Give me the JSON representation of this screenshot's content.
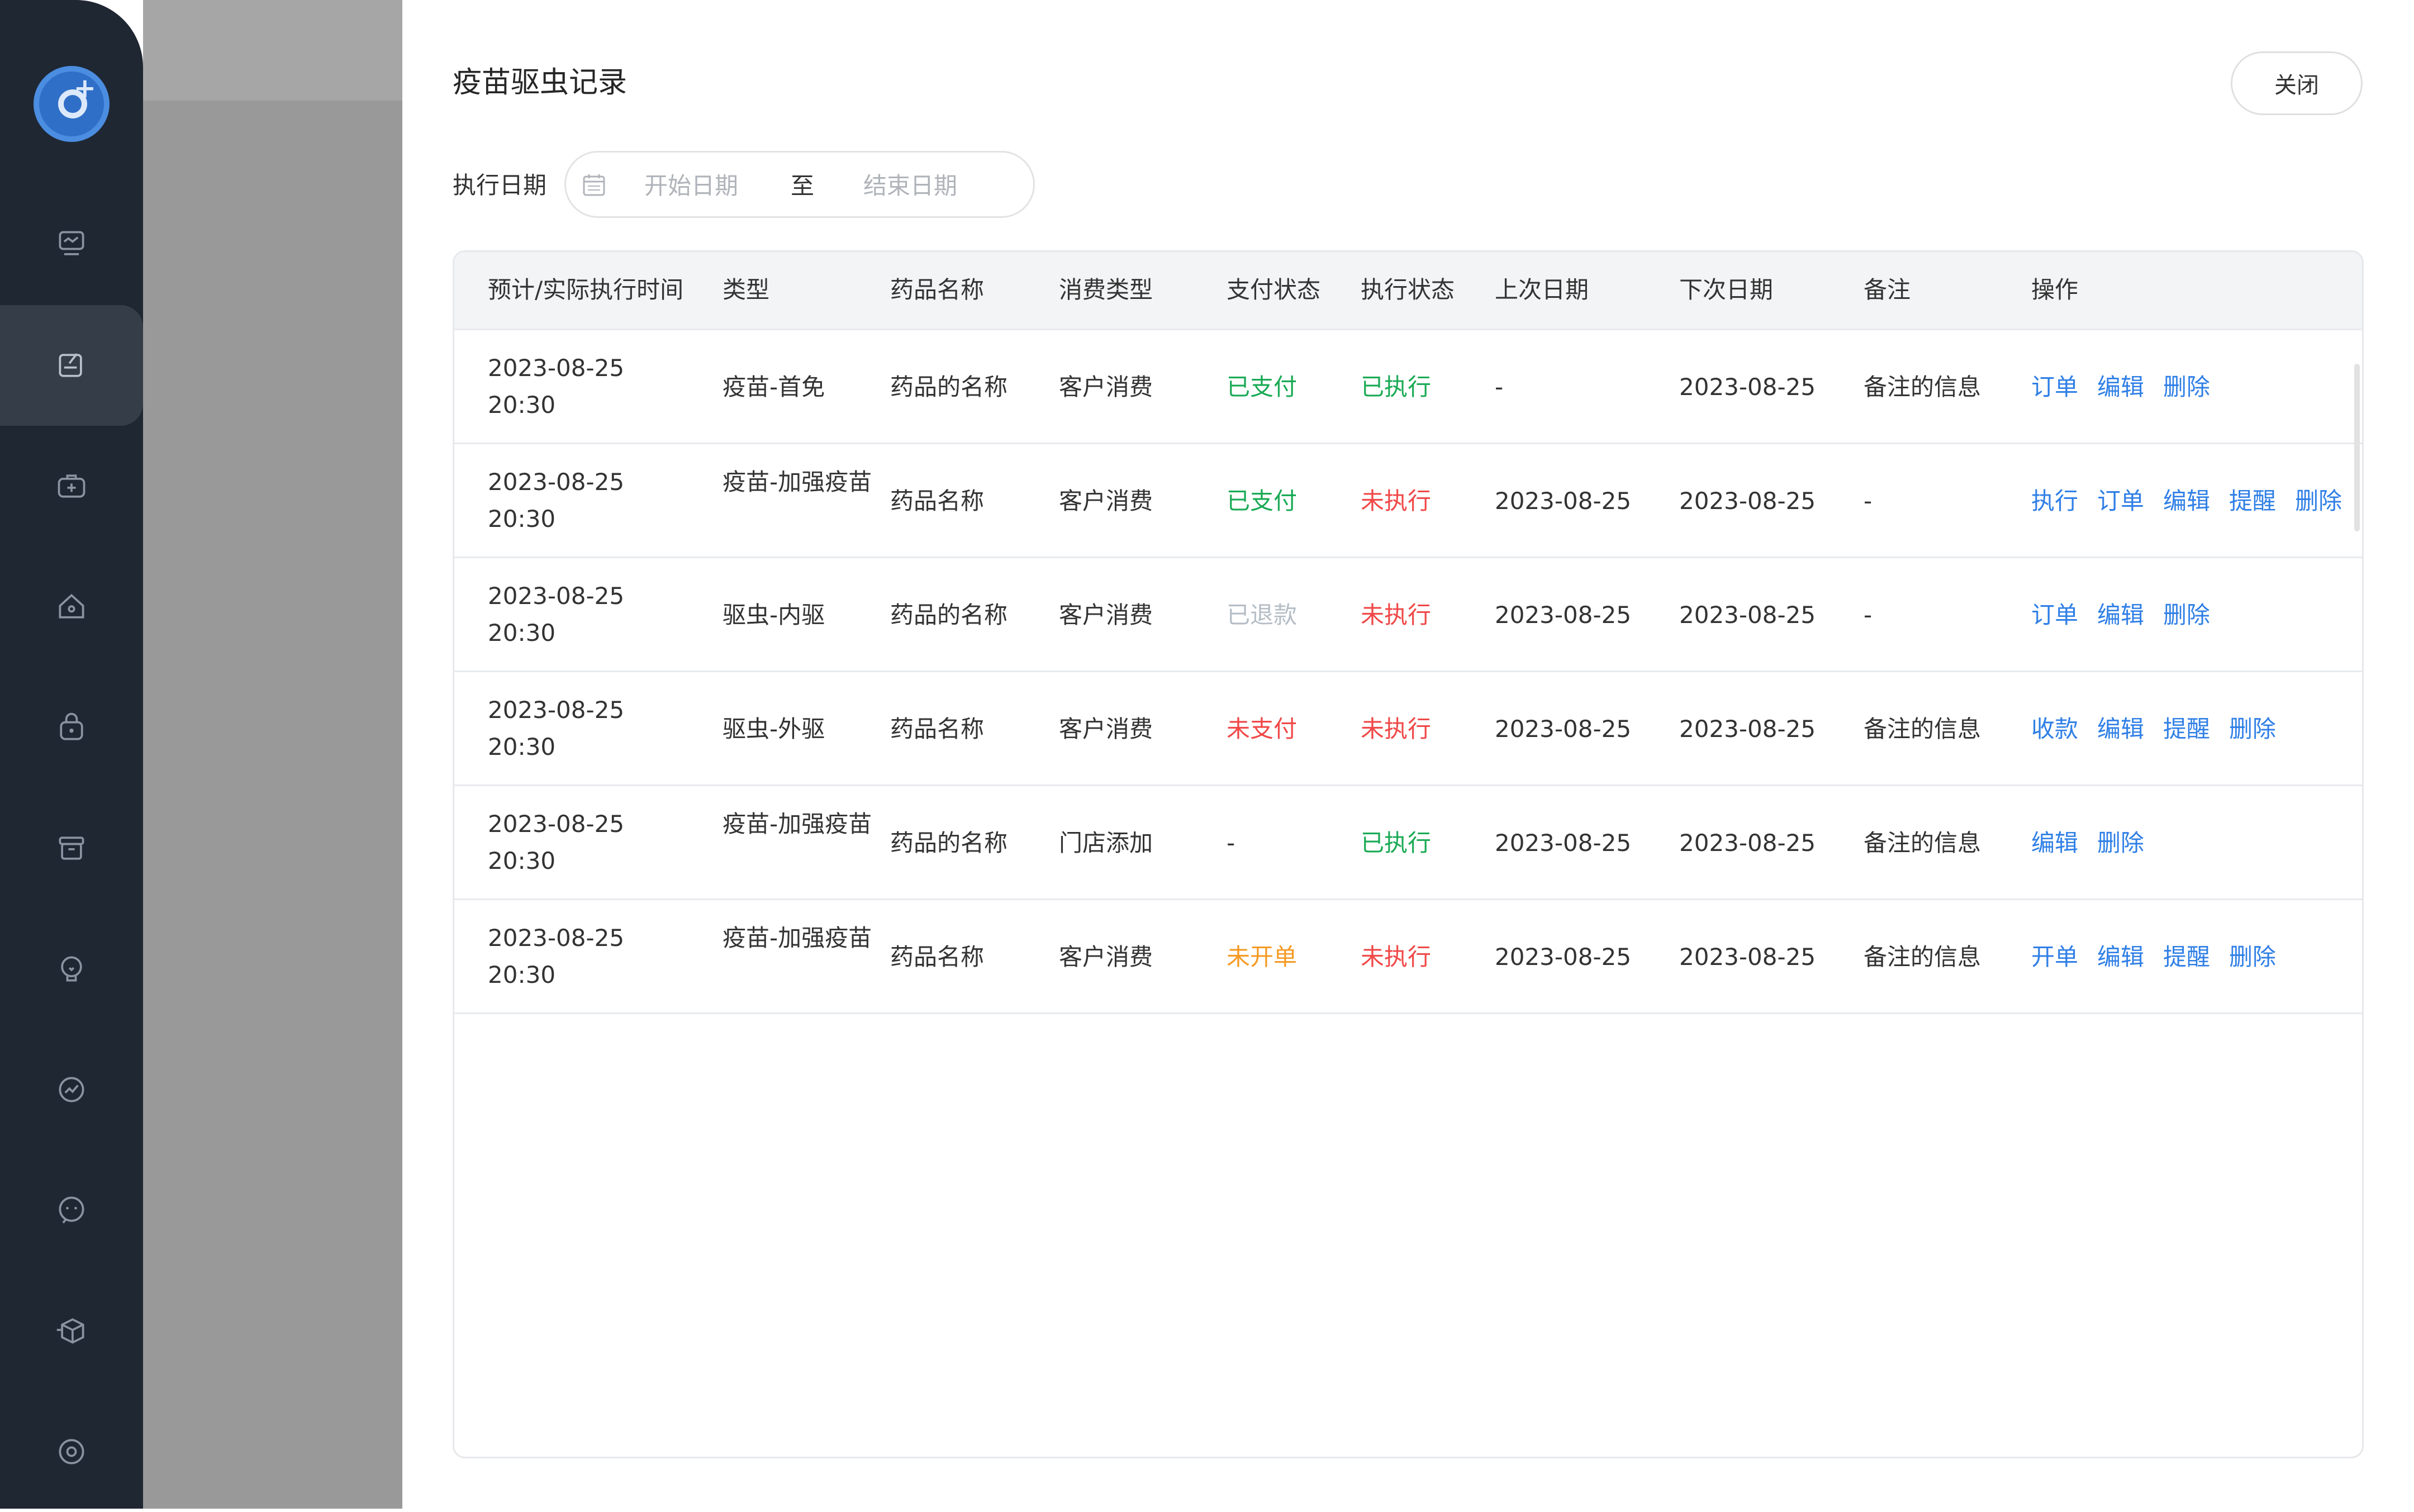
{
  "sidebar": {
    "logo": "pet-hospital-logo",
    "items": [
      {
        "icon": "monitor-icon"
      },
      {
        "icon": "record-edit-icon",
        "active": true
      },
      {
        "icon": "medical-kit-icon"
      },
      {
        "icon": "home-icon"
      },
      {
        "icon": "shopping-bag-icon"
      },
      {
        "icon": "archive-box-icon"
      },
      {
        "icon": "idea-icon"
      },
      {
        "icon": "trend-chart-icon"
      },
      {
        "icon": "chat-icon"
      },
      {
        "icon": "delivery-box-icon"
      },
      {
        "icon": "settings-icon"
      }
    ]
  },
  "modal": {
    "title": "疫苗驱虫记录",
    "close_label": "关闭"
  },
  "filter": {
    "label": "执行日期",
    "start_placeholder": "开始日期",
    "separator": "至",
    "end_placeholder": "结束日期"
  },
  "table": {
    "headers": [
      "预计/实际执行时间",
      "类型",
      "药品名称",
      "消费类型",
      "支付状态",
      "执行状态",
      "上次日期",
      "下次日期",
      "备注",
      "操作"
    ],
    "rows": [
      {
        "date": "2023-08-25",
        "time": "20:30",
        "type": "疫苗-首免",
        "drug": "药品的名称",
        "consume": "客户消费",
        "pay": "已支付",
        "exec": "已执行",
        "last": "-",
        "next": "2023-08-25",
        "note": "备注的信息",
        "actions": [
          "订单",
          "编辑",
          "删除"
        ]
      },
      {
        "date": "2023-08-25",
        "time": "20:30",
        "type": "疫苗-加强疫苗",
        "drug": "药品名称",
        "consume": "客户消费",
        "pay": "已支付",
        "exec": "未执行",
        "last": "2023-08-25",
        "next": "2023-08-25",
        "note": "-",
        "actions": [
          "执行",
          "订单",
          "编辑",
          "提醒",
          "删除"
        ]
      },
      {
        "date": "2023-08-25",
        "time": "20:30",
        "type": "驱虫-内驱",
        "drug": "药品的名称",
        "consume": "客户消费",
        "pay": "已退款",
        "exec": "未执行",
        "last": "2023-08-25",
        "next": "2023-08-25",
        "note": "-",
        "actions": [
          "订单",
          "编辑",
          "删除"
        ]
      },
      {
        "date": "2023-08-25",
        "time": "20:30",
        "type": "驱虫-外驱",
        "drug": "药品名称",
        "consume": "客户消费",
        "pay": "未支付",
        "exec": "未执行",
        "last": "2023-08-25",
        "next": "2023-08-25",
        "note": "备注的信息",
        "actions": [
          "收款",
          "编辑",
          "提醒",
          "删除"
        ]
      },
      {
        "date": "2023-08-25",
        "time": "20:30",
        "type": "疫苗-加强疫苗",
        "drug": "药品的名称",
        "consume": "门店添加",
        "pay": "-",
        "exec": "已执行",
        "last": "2023-08-25",
        "next": "2023-08-25",
        "note": "备注的信息",
        "actions": [
          "编辑",
          "删除"
        ]
      },
      {
        "date": "2023-08-25",
        "time": "20:30",
        "type": "疫苗-加强疫苗",
        "drug": "药品名称",
        "consume": "客户消费",
        "pay": "未开单",
        "exec": "未执行",
        "last": "2023-08-25",
        "next": "2023-08-25",
        "note": "备注的信息",
        "actions": [
          "开单",
          "编辑",
          "提醒",
          "删除"
        ]
      }
    ]
  },
  "colors": {
    "sidebar_bg": "#1f2733",
    "link": "#2f7fe6",
    "paid": "#1aaa55",
    "executed": "#1aaa55",
    "unexecuted": "#f04848",
    "unpaid": "#f04848",
    "refunded": "#b5bdc6",
    "not_ordered": "#f59a23"
  }
}
